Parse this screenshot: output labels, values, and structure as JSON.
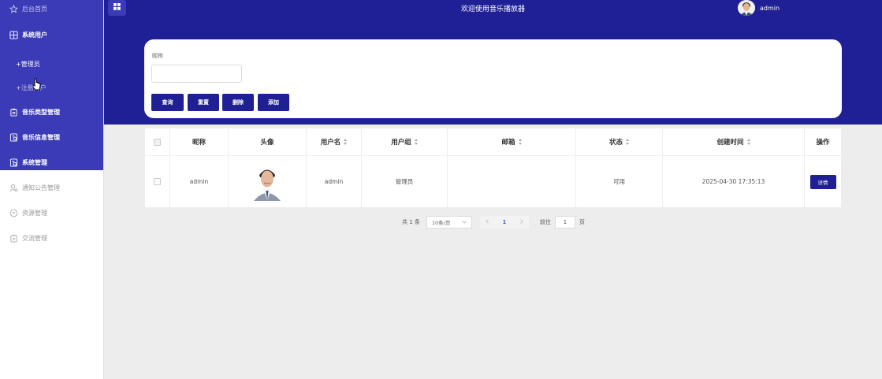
{
  "sidebar": {
    "items": [
      {
        "label": "后台首页",
        "icon": "star-icon"
      },
      {
        "label": "系统用户",
        "icon": "grid-icon"
      },
      {
        "label": "+管理员"
      },
      {
        "label": "+注册用户"
      },
      {
        "label": "音乐类型管理",
        "icon": "clipboard-icon"
      },
      {
        "label": "音乐信息管理",
        "icon": "document-icon"
      },
      {
        "label": "系统管理",
        "icon": "settings-doc-icon"
      },
      {
        "label": "通知公告管理",
        "icon": "user-icon"
      },
      {
        "label": "资源管理",
        "icon": "chat-icon"
      },
      {
        "label": "交流管理",
        "icon": "clipboard-icon"
      }
    ]
  },
  "header": {
    "title": "欢迎使用音乐播放器",
    "user": "admin"
  },
  "search": {
    "nickname_label": "昵称",
    "nickname_value": "",
    "buttons": {
      "query": "查询",
      "reset": "重置",
      "delete": "删除",
      "add": "添加"
    }
  },
  "table": {
    "columns": [
      "昵称",
      "头像",
      "用户名",
      "用户组",
      "邮箱",
      "状态",
      "创建时间",
      "操作"
    ],
    "rows": [
      {
        "nickname": "admin",
        "username": "admin",
        "group": "管理员",
        "email": "",
        "status": "可用",
        "created": "2025-04-30 17:35:13",
        "action": "详情"
      }
    ]
  },
  "pagination": {
    "total": "共 1 条",
    "page_size": "10条/页",
    "current_page": "1",
    "goto_label": "前往",
    "goto_value": "1",
    "page_suffix": "页"
  },
  "colors": {
    "header": "#1f1f96",
    "sidebar": "#3b3bb8",
    "button": "#1f1f96"
  }
}
